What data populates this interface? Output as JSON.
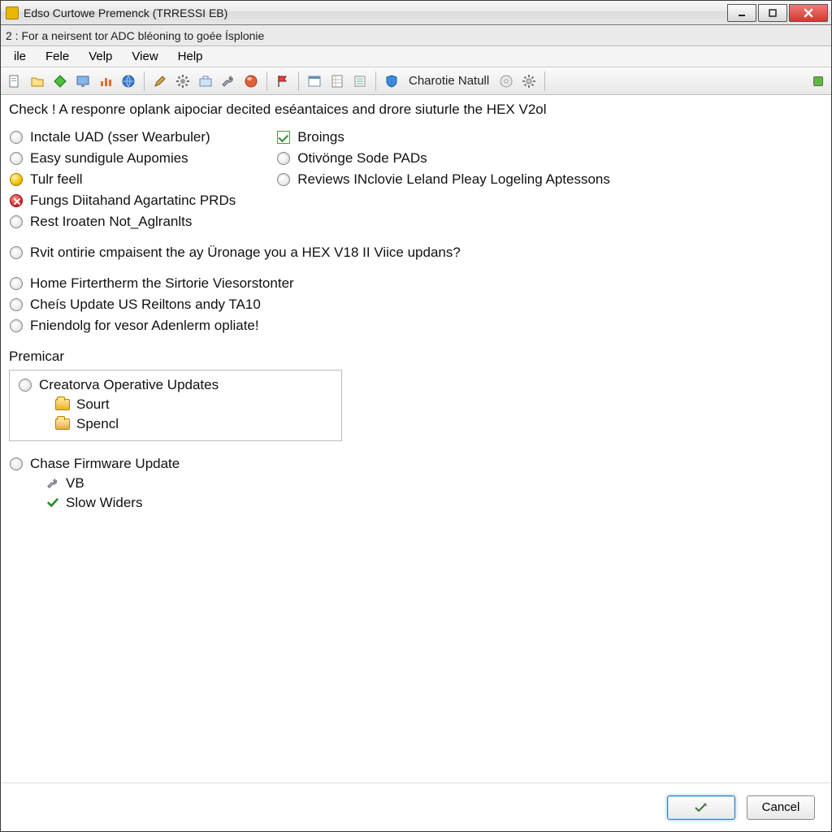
{
  "title": "Edso Curtowe Premenck (TRRESSI EB)",
  "subheader": "2 : For a neirsent tor ADC bléoning to goée Ísplonie",
  "menus": [
    "ile",
    "Fele",
    "Velp",
    "View",
    "Help"
  ],
  "toolbar": {
    "charotie_label": "Charotie Natull"
  },
  "headline": "Check ! A responre oplank aipociar decited eséantaices and drore siuturle the HEX V2ol",
  "left_items": [
    {
      "icon": "bullet",
      "label": "Inctale UAD (sser Wearbuler)"
    },
    {
      "icon": "bullet",
      "label": "Easy sundigule Aupomies"
    },
    {
      "icon": "dot-yellow",
      "label": "Tulr feell"
    },
    {
      "icon": "x-red",
      "label": "Fungs Diitahand Agartatinc PRDs"
    },
    {
      "icon": "bullet",
      "label": "Rest Iroaten Not_Aglranlts"
    }
  ],
  "right_items": [
    {
      "icon": "chk-green",
      "label": "Broings"
    },
    {
      "icon": "bullet",
      "label": "Otivönge Sode PADs"
    },
    {
      "icon": "bullet",
      "label": "Reviews INclovie Leland Pleay Logeling Aptessons"
    }
  ],
  "mid_items": [
    {
      "icon": "bullet",
      "label": "Rvit ontirie cmpaisent the ay Üronage you a HEX V18 II Viice updans?"
    }
  ],
  "lower_items": [
    {
      "icon": "bullet",
      "label": "Home Firtertherm the Sirtorie Viesorstonter"
    },
    {
      "icon": "bullet",
      "label": "Cheís Update US Reiltons andy TA10"
    },
    {
      "icon": "bullet",
      "label": "Fniendolg for vesor Adenlerm opliate!"
    }
  ],
  "panel_heading": "Premicar",
  "panel": {
    "title": "Creatorva Operative Updates",
    "children": [
      {
        "icon": "folder",
        "label": "Sourt"
      },
      {
        "icon": "folder-alt",
        "label": "Spencl"
      }
    ]
  },
  "firmware": {
    "title": "Chase Firmware Update",
    "children": [
      {
        "icon": "wrench",
        "label": "VB"
      },
      {
        "icon": "check",
        "label": "Slow Widers"
      }
    ]
  },
  "footer": {
    "ok_label": "",
    "cancel_label": "Cancel"
  }
}
